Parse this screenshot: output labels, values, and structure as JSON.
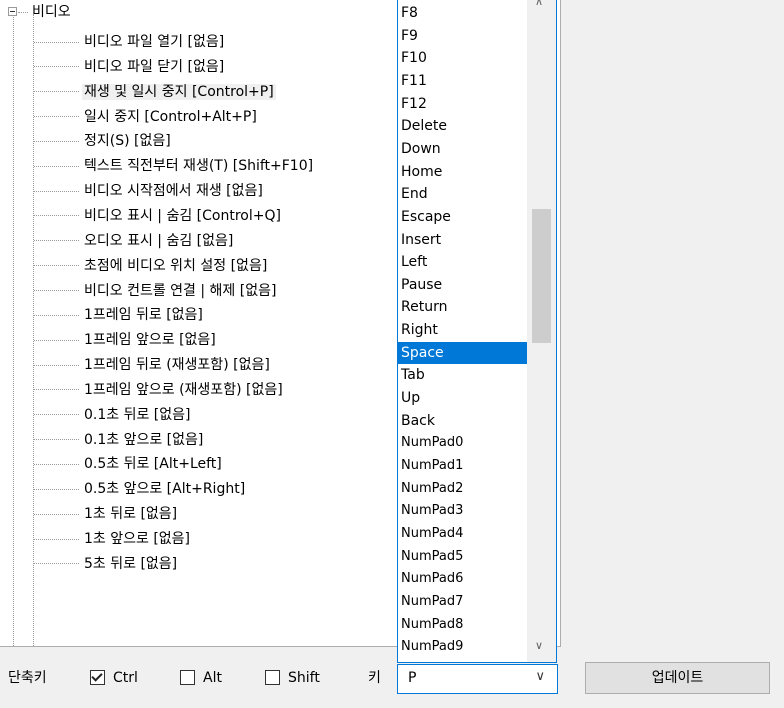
{
  "tree": {
    "root": "비디오",
    "items": [
      "비디오 파일 열기 [없음]",
      "비디오 파일 닫기 [없음]",
      "재생 및 일시 중지 [Control+P]",
      "일시 중지 [Control+Alt+P]",
      "정지(S) [없음]",
      "텍스트 직전부터 재생(T) [Shift+F10]",
      "비디오 시작점에서 재생 [없음]",
      "비디오 표시 | 숨김 [Control+Q]",
      "오디오 표시 | 숨김 [없음]",
      "초점에 비디오 위치 설정 [없음]",
      "비디오 컨트롤 연결 | 해제 [없음]",
      "1프레임 뒤로 [없음]",
      "1프레임 앞으로 [없음]",
      "1프레임 뒤로 (재생포함) [없음]",
      "1프레임 앞으로 (재생포함) [없음]",
      "0.1초 뒤로 [없음]",
      "0.1초 앞으로 [없음]",
      "0.5초 뒤로 [Alt+Left]",
      "0.5초 앞으로 [Alt+Right]",
      "1초 뒤로 [없음]",
      "1초 앞으로 [없음]",
      "5초 뒤로 [없음]"
    ],
    "selected_index": 2
  },
  "key_list": {
    "items": [
      "F8",
      "F9",
      "F10",
      "F11",
      "F12",
      "Delete",
      "Down",
      "Home",
      "End",
      "Escape",
      "Insert",
      "Left",
      "Pause",
      "Return",
      "Right",
      "Space",
      "Tab",
      "Up",
      "Back",
      "NumPad0",
      "NumPad1",
      "NumPad2",
      "NumPad3",
      "NumPad4",
      "NumPad5",
      "NumPad6",
      "NumPad7",
      "NumPad8",
      "NumPad9"
    ],
    "selected": "Space"
  },
  "bottom": {
    "shortcut_label": "단축키",
    "ctrl_label": "Ctrl",
    "ctrl_checked": true,
    "alt_label": "Alt",
    "alt_checked": false,
    "shift_label": "Shift",
    "shift_checked": false,
    "key_label": "키",
    "key_value": "P",
    "update_label": "업데이트"
  }
}
